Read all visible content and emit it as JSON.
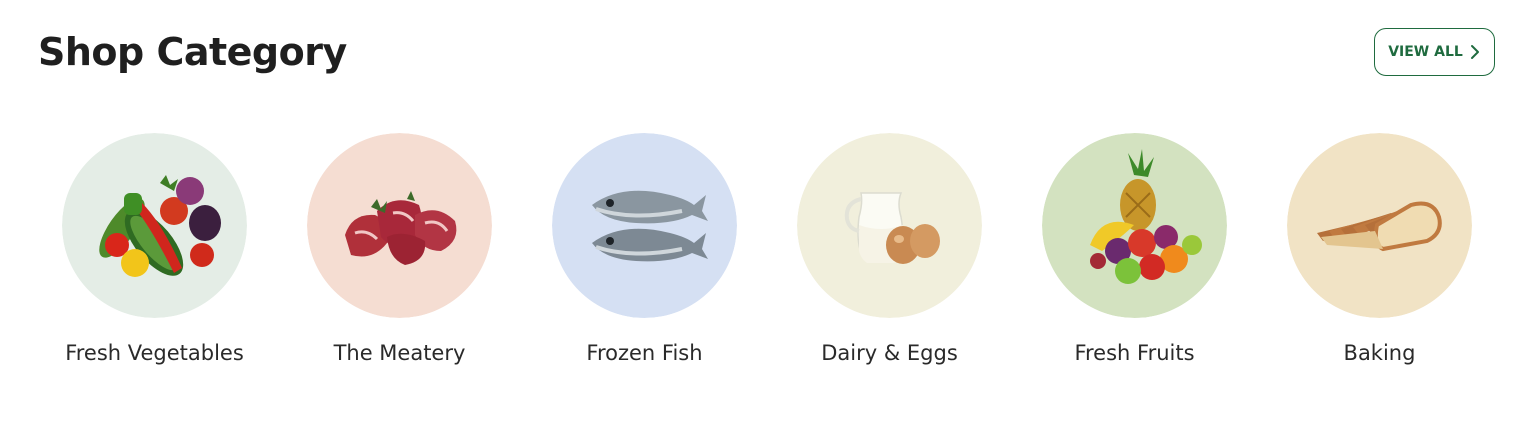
{
  "section": {
    "title": "Shop Category",
    "view_all_label": "VIEW ALL",
    "accent_color": "#1f6b3f"
  },
  "categories": [
    {
      "label": "Fresh Vegetables",
      "icon": "vegetables-image",
      "bg": "#e4ede6"
    },
    {
      "label": "The Meatery",
      "icon": "meat-image",
      "bg": "#f5ddd2"
    },
    {
      "label": "Frozen Fish",
      "icon": "fish-image",
      "bg": "#d5e0f3"
    },
    {
      "label": "Dairy & Eggs",
      "icon": "dairy-eggs-image",
      "bg": "#f1efdc"
    },
    {
      "label": "Fresh Fruits",
      "icon": "fruits-image",
      "bg": "#d3e2c0"
    },
    {
      "label": "Baking",
      "icon": "bread-image",
      "bg": "#f1e3c5"
    }
  ]
}
